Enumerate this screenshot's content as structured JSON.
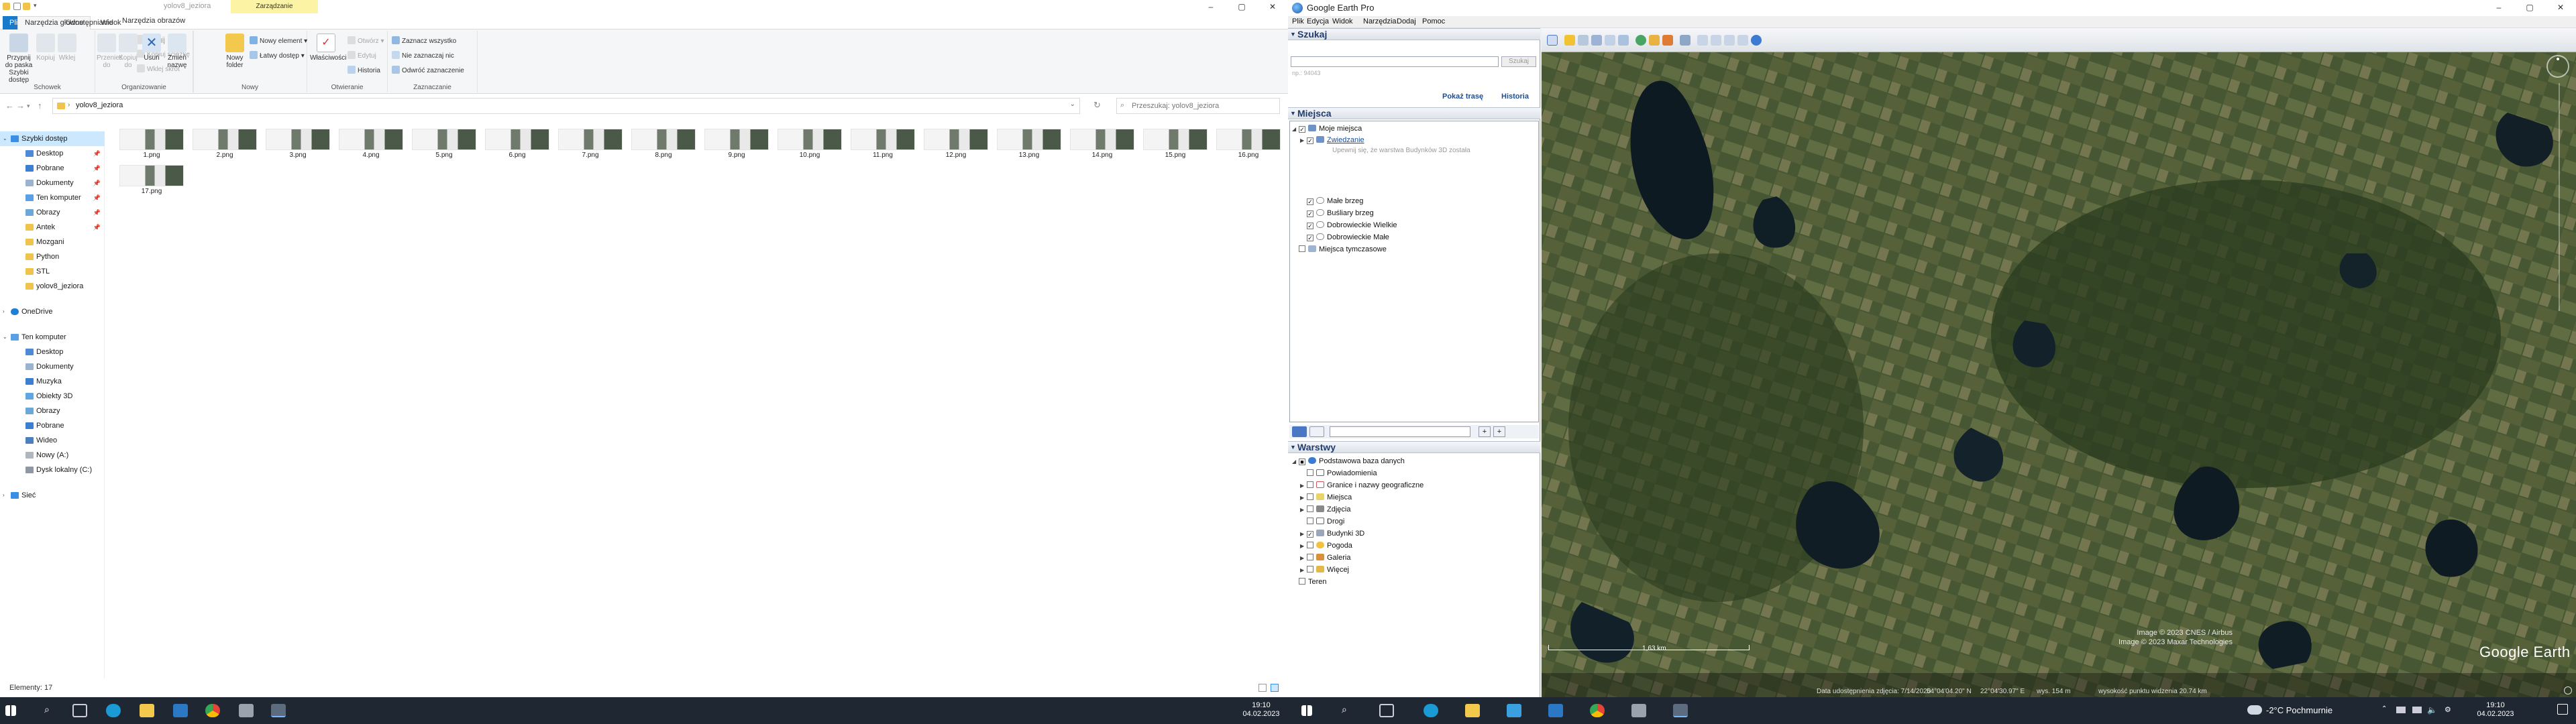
{
  "explorer": {
    "window_title": "yolov8_jeziora",
    "context_group": "Zarządzanie",
    "tabs": [
      "Plik",
      "Narzędzia główne",
      "Udostępnianie",
      "Widok",
      "Narzędzia obrazów"
    ],
    "ribbon": {
      "pin_label": "Przypnij do paska Szybki dostęp",
      "copy": "Kopiuj",
      "paste": "Wklej",
      "cut": "Wytnij",
      "copy_path": "Kopiuj ścieżkę",
      "paste_shortcut": "Wklej skrót",
      "move_to": "Przenieś do",
      "copy_to": "Kopiuj do",
      "delete": "Usuń",
      "rename": "Zmień nazwę",
      "new_folder": "Nowy folder",
      "new_item": "Nowy element",
      "easy_access": "Łatwy dostęp",
      "properties": "Właściwości",
      "open": "Otwórz",
      "edit": "Edytuj",
      "history": "Historia",
      "select_all": "Zaznacz wszystko",
      "select_none": "Nie zaznaczaj nic",
      "invert_selection": "Odwróć zaznaczenie",
      "groups": [
        "Schowek",
        "Organizowanie",
        "Nowy",
        "Otwieranie",
        "Zaznaczanie"
      ]
    },
    "address": {
      "path": "yolov8_jeziora",
      "search_placeholder": "Przeszukaj: yolov8_jeziora"
    },
    "nav": {
      "quick_access": "Szybki dostęp",
      "quick_items": [
        "Desktop",
        "Pobrane",
        "Dokumenty",
        "Ten komputer",
        "Obrazy",
        "Antek",
        "Mozgani",
        "Python",
        "STL",
        "yolov8_jeziora"
      ],
      "onedrive": "OneDrive",
      "this_pc": "Ten komputer",
      "pc_items": [
        "Desktop",
        "Dokumenty",
        "Muzyka",
        "Obiekty 3D",
        "Obrazy",
        "Pobrane",
        "Wideo",
        "Nowy (A:)",
        "Dysk lokalny (C:)"
      ],
      "network": "Sieć"
    },
    "files": [
      "1.png",
      "2.png",
      "3.png",
      "4.png",
      "5.png",
      "6.png",
      "7.png",
      "8.png",
      "9.png",
      "10.png",
      "11.png",
      "12.png",
      "13.png",
      "14.png",
      "15.png",
      "16.png",
      "17.png"
    ],
    "status": "Elementy: 17"
  },
  "earth": {
    "title": "Google Earth Pro",
    "menu": [
      "Plik",
      "Edycja",
      "Widok",
      "Narzędzia",
      "Dodaj",
      "Pomoc"
    ],
    "search": {
      "header": "Szukaj",
      "button": "Szukaj",
      "hint": "np.: 94043",
      "route_link": "Pokaż trasę",
      "history_link": "Historia"
    },
    "places": {
      "header": "Miejsca",
      "my_places": "Moje miejsca",
      "sightseeing": "Zwiedzanie",
      "sightseeing_note": "Upewnij się, że warstwa Budynków 3D została",
      "items": [
        "Małe brzeg",
        "Buśliary brzeg",
        "Dobrowieckie Wielkie",
        "Dobrowieckie Małe"
      ],
      "temporary": "Miejsca tymczasowe"
    },
    "layers": {
      "header": "Warstwy",
      "primary_db": "Podstawowa baza danych",
      "items": [
        "Powiadomienia",
        "Granice i nazwy geograficzne",
        "Miejsca",
        "Zdjęcia",
        "Drogi",
        "Budynki 3D",
        "Pogoda",
        "Galeria",
        "Więcej",
        "Teren"
      ]
    },
    "map": {
      "credit1": "Image © 2023 CNES / Airbus",
      "credit2": "Image © 2023 Maxar Technologies",
      "scale": "1,63 km",
      "logo": "Google Earth",
      "status_date": "Data udostępnienia zdjęcia: 7/14/2020",
      "status_lat": "54°04'04.20\" N",
      "status_lon": "22°04'30.97\" E",
      "status_elev": "wys. 154 m",
      "status_eye": "wysokość punktu widzenia 20.74 km"
    }
  },
  "taskbar": {
    "left_time": "19:10",
    "left_date": "04.02.2023",
    "weather": "-2°C Pochmurnie",
    "right_time": "19:10",
    "right_date": "04.02.2023"
  }
}
